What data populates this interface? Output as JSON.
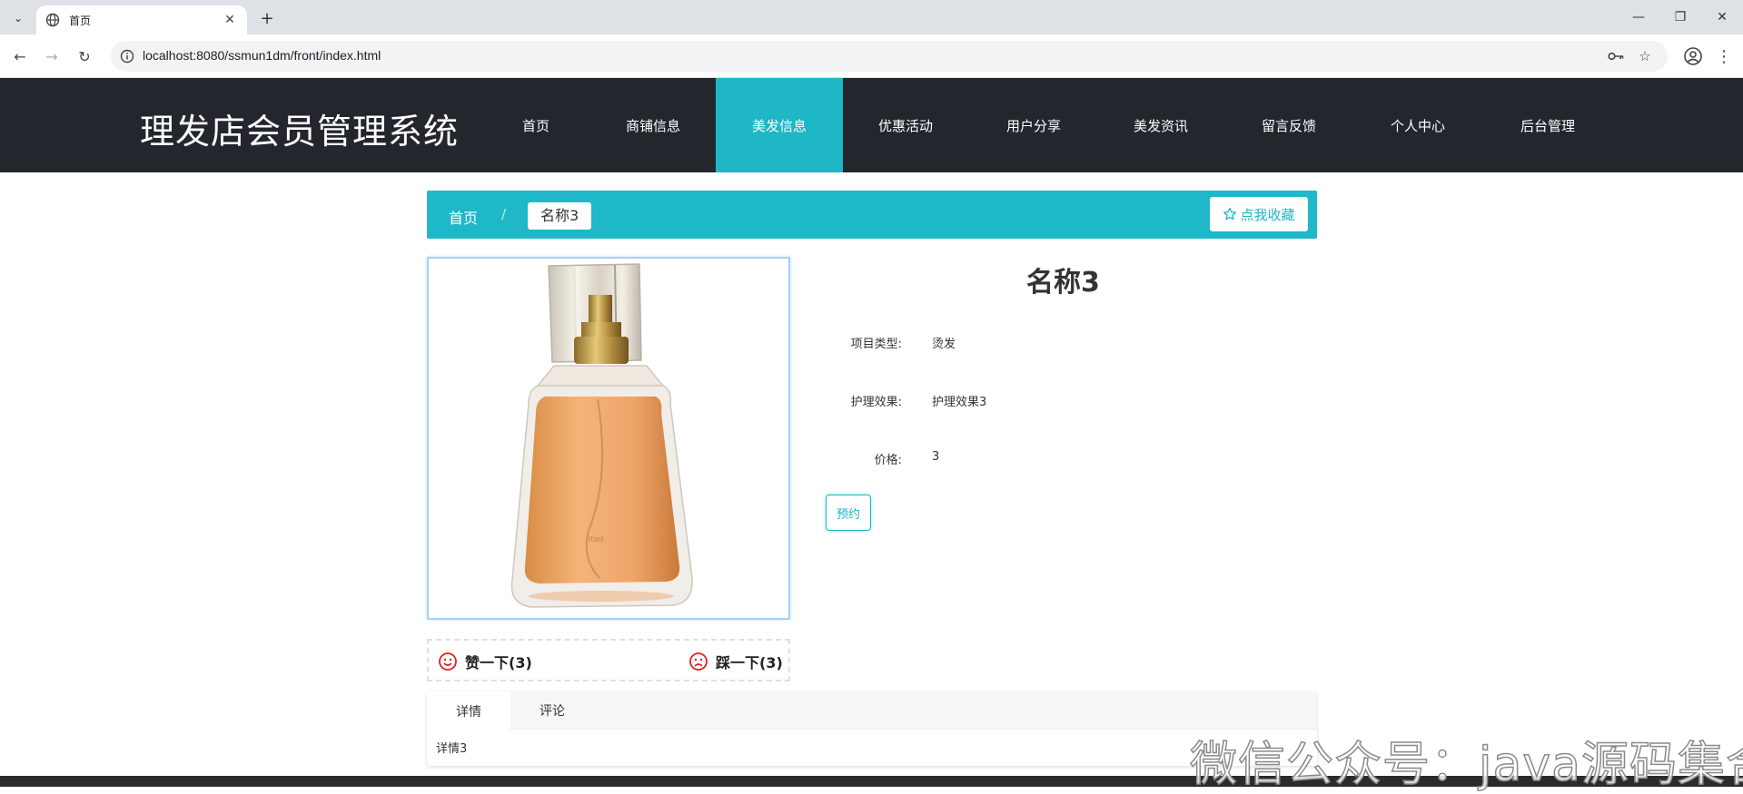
{
  "browser": {
    "tab_title": "首页",
    "url": "localhost:8080/ssmun1dm/front/index.html"
  },
  "site": {
    "title": "理发店会员管理系统",
    "nav": [
      {
        "label": "首页"
      },
      {
        "label": "商铺信息"
      },
      {
        "label": "美发信息"
      },
      {
        "label": "优惠活动"
      },
      {
        "label": "用户分享"
      },
      {
        "label": "美发资讯"
      },
      {
        "label": "留言反馈"
      },
      {
        "label": "个人中心"
      },
      {
        "label": "后台管理"
      }
    ],
    "active_nav": "美发信息",
    "accent_color": "#1fb6c6",
    "header_color": "#23262d"
  },
  "breadcrumb": {
    "home": "首页",
    "separator": "/",
    "current": "名称3",
    "favorite_label": "点我收藏"
  },
  "product": {
    "name": "名称3",
    "fields": [
      {
        "label": "项目类型:",
        "value": "烫发"
      },
      {
        "label": "护理效果:",
        "value": "护理效果3"
      },
      {
        "label": "价格:",
        "value": "3"
      }
    ],
    "reserve_label": "预约",
    "image_alt": "perfume bottle"
  },
  "votes": {
    "like_label": "赞一下(3)",
    "dislike_label": "踩一下(3)"
  },
  "tabs": {
    "items": [
      {
        "label": "详情"
      },
      {
        "label": "评论"
      }
    ],
    "active": "详情",
    "content": "详情3"
  },
  "watermark": "微信公众号：java源码集合"
}
